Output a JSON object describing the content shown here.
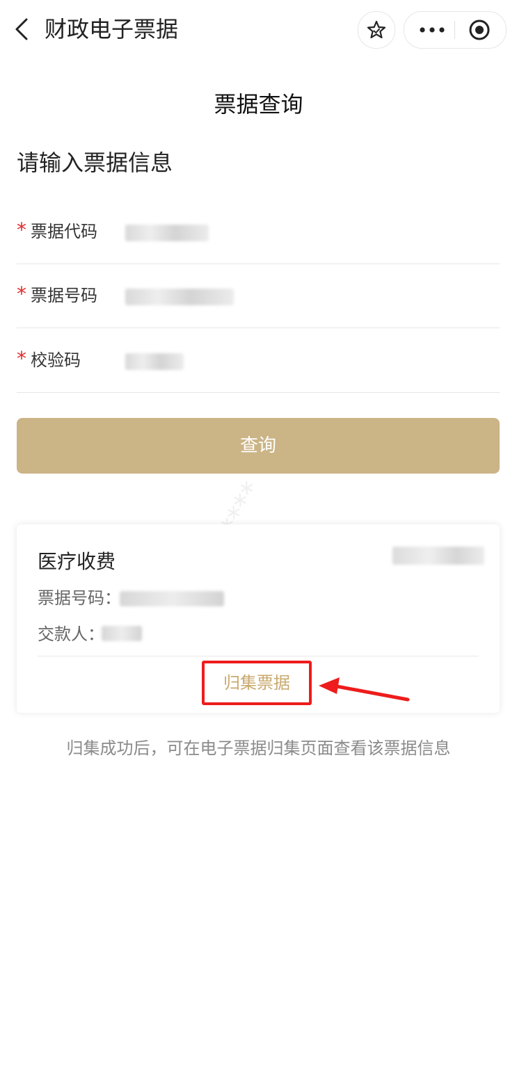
{
  "nav": {
    "title": "财政电子票据"
  },
  "page_title": "票据查询",
  "section_title": "请输入票据信息",
  "form": {
    "rows": [
      {
        "required_mark": "*",
        "label": "票据代码"
      },
      {
        "required_mark": "*",
        "label": "票据号码"
      },
      {
        "required_mark": "*",
        "label": "校验码"
      }
    ],
    "query_button": "查询"
  },
  "result_card": {
    "title": "医疗收费",
    "invoice_number_label": "票据号码：",
    "payer_label": "交款人：",
    "collect_button": "归集票据"
  },
  "hint": "归集成功后，可在电子票据归集页面查看该票据信息",
  "colors": {
    "accent": "#cbb486",
    "collect_text": "#c9a96e",
    "required": "#e12a2a",
    "highlight_box": "#ee1c1c"
  }
}
